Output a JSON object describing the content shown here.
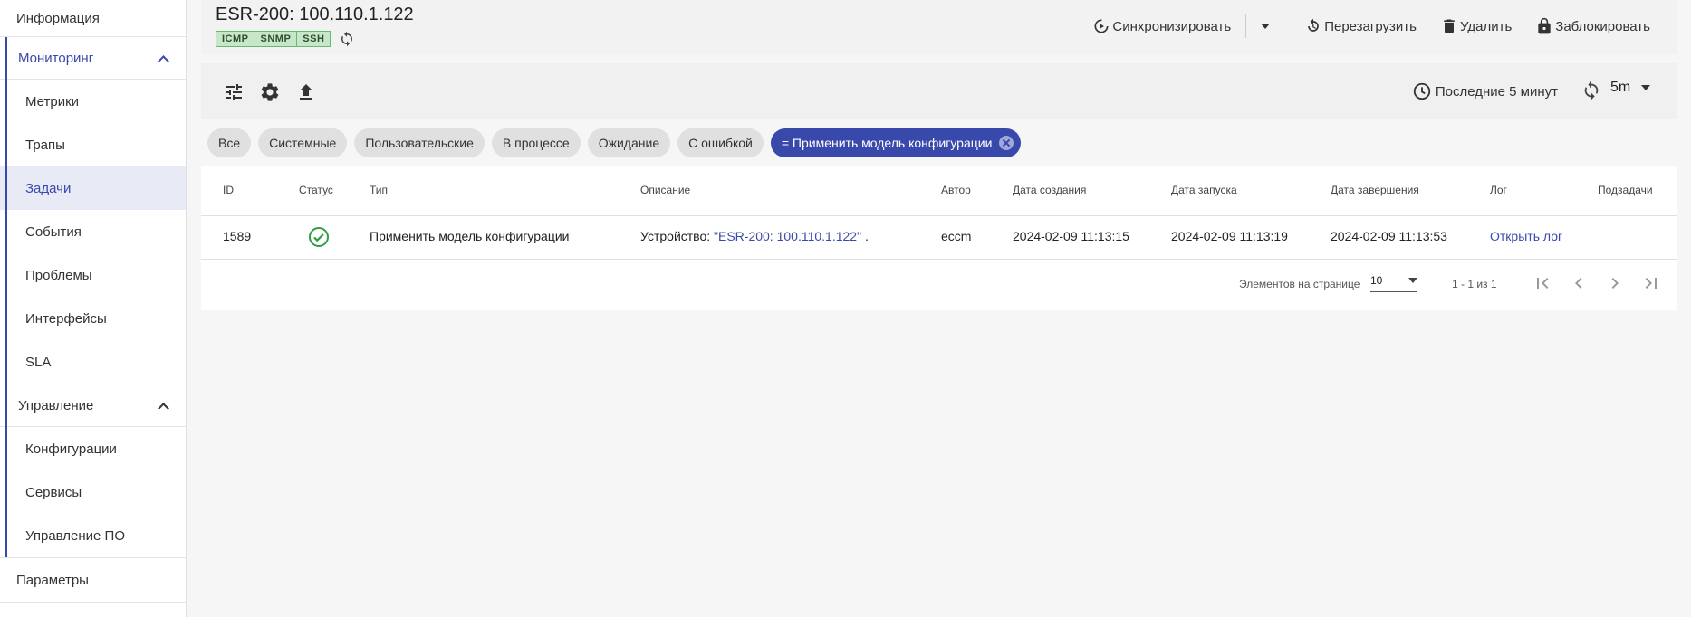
{
  "sidebar": {
    "info": "Информация",
    "monitoring": {
      "label": "Мониторинг",
      "items": [
        "Метрики",
        "Трапы",
        "Задачи",
        "События",
        "Проблемы",
        "Интерфейсы",
        "SLA"
      ]
    },
    "management": {
      "label": "Управление",
      "items": [
        "Конфигурации",
        "Сервисы",
        "Управление ПО"
      ]
    },
    "params": "Параметры"
  },
  "header": {
    "title": "ESR-200: 100.110.1.122",
    "badges": [
      "ICMP",
      "SNMP",
      "SSH"
    ],
    "actions": {
      "sync": "Синхронизировать",
      "reboot": "Перезагрузить",
      "delete": "Удалить",
      "lock": "Заблокировать"
    }
  },
  "toolbar": {
    "period": "Последние 5 минут",
    "interval": "5m"
  },
  "filters": {
    "chips": [
      "Все",
      "Системные",
      "Пользовательские",
      "В процессе",
      "Ожидание",
      "С ошибкой"
    ],
    "active": "= Применить модель конфигурации"
  },
  "table": {
    "headers": {
      "id": "ID",
      "status": "Статус",
      "type": "Тип",
      "description": "Описание",
      "author": "Автор",
      "created": "Дата создания",
      "started": "Дата запуска",
      "finished": "Дата завершения",
      "log": "Лог",
      "subtasks": "Подзадачи"
    },
    "rows": [
      {
        "id": "1589",
        "status_icon": "check-circle-icon",
        "type": "Применить модель конфигурации",
        "desc_prefix": "Устройство: ",
        "desc_link": "\"ESR-200: 100.110.1.122\"",
        "desc_suffix": " .",
        "author": "eccm",
        "created": "2024-02-09 11:13:15",
        "started": "2024-02-09 11:13:19",
        "finished": "2024-02-09 11:13:53",
        "log": "Открыть лог"
      }
    ]
  },
  "pagination": {
    "label": "Элементов на странице",
    "page_size": "10",
    "range": "1 - 1 из 1"
  },
  "colors": {
    "accent": "#3949ab",
    "success": "#2e9e44",
    "badge_bg": "#c8e6c9"
  }
}
